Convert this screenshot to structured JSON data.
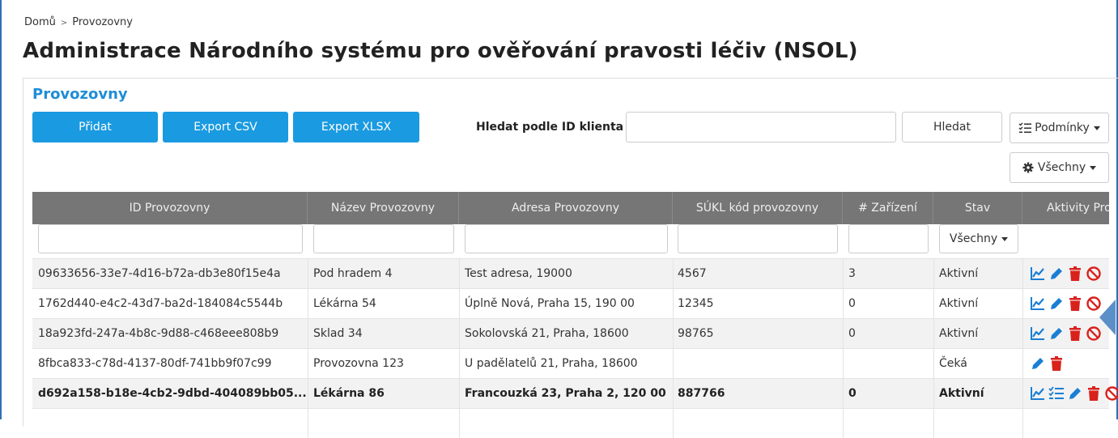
{
  "breadcrumb": {
    "home": "Domů",
    "current": "Provozovny"
  },
  "page_title": "Administrace Národního systému pro ověřování pravosti léčiv (NSOL)",
  "panel_title": "Provozovny",
  "toolbar": {
    "add_label": "Přidat",
    "export_csv_label": "Export CSV",
    "export_xlsx_label": "Export XLSX",
    "search_label": "Hledat podle ID klienta",
    "search_value": "",
    "search_button_label": "Hledat",
    "conditions_label": "Podmínky",
    "all_label": "Všechny"
  },
  "table": {
    "columns": [
      "ID Provozovny",
      "Název Provozovny",
      "Adresa Provozovny",
      "SÚKL kód provozovny",
      "# Zařízení",
      "Stav",
      "Aktivity Pro"
    ],
    "status_filter": "Všechny",
    "rows": [
      {
        "id": "09633656-33e7-4d16-b72a-db3e80f15e4a",
        "name": "Pod hradem 4",
        "address": "Test adresa, 19000",
        "sukl": "4567",
        "devices": "3",
        "status": "Aktivní",
        "actions": [
          "chart-icon",
          "edit-icon",
          "delete-icon",
          "block-icon"
        ]
      },
      {
        "id": "1762d440-e4c2-43d7-ba2d-184084c5544b",
        "name": "Lékárna 54",
        "address": "Úplně Nová, Praha 15, 190 00",
        "sukl": "12345",
        "devices": "0",
        "status": "Aktivní",
        "actions": [
          "chart-icon",
          "edit-icon",
          "delete-icon",
          "block-icon"
        ]
      },
      {
        "id": "18a923fd-247a-4b8c-9d88-c468eee808b9",
        "name": "Sklad 34",
        "address": "Sokolovská 21, Praha, 18600",
        "sukl": "98765",
        "devices": "0",
        "status": "Aktivní",
        "actions": [
          "chart-icon",
          "edit-icon",
          "delete-icon",
          "block-icon"
        ]
      },
      {
        "id": "8fbca833-c78d-4137-80df-741bb9f07c99",
        "name": "Provozovna 123",
        "address": "U padělatelů 21, Praha, 18600",
        "sukl": "",
        "devices": "",
        "status": "Čeká",
        "actions": [
          "edit-icon",
          "delete-icon"
        ]
      },
      {
        "id": "d692a158-b18e-4cb2-9dbd-404089bb05...",
        "name": "Lékárna 86",
        "address": "Francouzká 23, Praha 2, 120 00",
        "sukl": "887766",
        "devices": "0",
        "status": "Aktivní",
        "actions": [
          "chart-icon",
          "checklist-icon",
          "edit-icon",
          "delete-icon",
          "block-icon"
        ]
      }
    ]
  },
  "colors": {
    "accent": "#1a9ae0",
    "header_bg": "#767676",
    "icon_blue": "#1a7fd4",
    "icon_red": "#d9211c"
  }
}
